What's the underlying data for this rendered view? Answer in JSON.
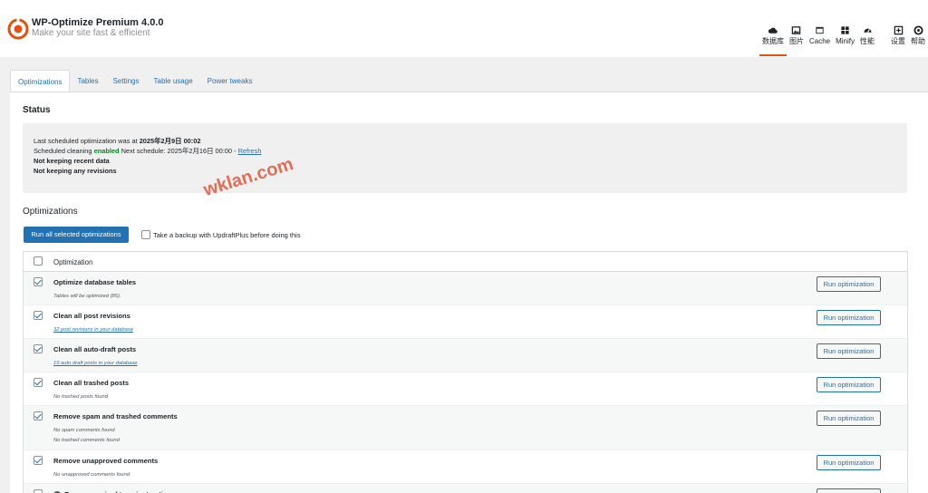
{
  "brand": {
    "title": "WP-Optimize Premium 4.0.0",
    "tagline": "Make your site fast & efficient",
    "accent": "#e5500f"
  },
  "topnav": [
    {
      "label": "数据库",
      "icon": "database-cloud-icon",
      "active": true
    },
    {
      "label": "图片",
      "icon": "image-icon",
      "active": false
    },
    {
      "label": "Cache",
      "icon": "cache-icon",
      "active": false
    },
    {
      "label": "Minify",
      "icon": "minify-grid-icon",
      "active": false
    },
    {
      "label": "性能",
      "icon": "speedometer-icon",
      "active": false
    },
    {
      "label": "设置",
      "icon": "settings-icon",
      "active": false
    },
    {
      "label": "帮助",
      "icon": "help-lifebuoy-icon",
      "active": false
    }
  ],
  "tabs": [
    {
      "label": "Optimizations",
      "active": true
    },
    {
      "label": "Tables",
      "active": false
    },
    {
      "label": "Settings",
      "active": false
    },
    {
      "label": "Table usage",
      "active": false
    },
    {
      "label": "Power tweaks",
      "active": false
    }
  ],
  "status": {
    "heading": "Status",
    "last_prefix": "Last scheduled optimization was at",
    "last_value": "2025年2月9日 00:02",
    "cleaning_prefix": "Scheduled cleaning",
    "cleaning_state": "enabled",
    "next_schedule": "Next schedule: 2025年2月16日 00:00 -",
    "refresh_label": "Refresh",
    "recent_data": "Not keeping recent data",
    "revisions": "Not keeping any revisions"
  },
  "optimizations": {
    "heading": "Optimizations",
    "run_all_label": "Run all selected optimizations",
    "backup_label": "Take a backup with UpdraftPlus before doing this",
    "backup_checked": false,
    "column_header": "Optimization",
    "header_checked": false,
    "run_label": "Run optimization",
    "rows": [
      {
        "title": "Optimize database tables",
        "checked": true,
        "subs": [
          "Tables will be optimized (85)."
        ],
        "sub_is_link": false
      },
      {
        "title": "Clean all post revisions",
        "checked": true,
        "subs": [
          "32 post revisions in your database"
        ],
        "sub_is_link": true
      },
      {
        "title": "Clean all auto-draft posts",
        "checked": true,
        "subs": [
          "19 auto draft posts in your database"
        ],
        "sub_is_link": true
      },
      {
        "title": "Clean all trashed posts",
        "checked": true,
        "subs": [
          "No trashed posts found"
        ],
        "sub_is_link": false
      },
      {
        "title": "Remove spam and trashed comments",
        "checked": true,
        "subs": [
          "No spam comments found",
          "No trashed comments found"
        ],
        "sub_is_link": false
      },
      {
        "title": "Remove unapproved comments",
        "checked": true,
        "subs": [
          "No unapproved comments found"
        ],
        "sub_is_link": false
      },
      {
        "title": "Remove expired transient options",
        "checked": false,
        "subs": [],
        "sub_is_link": false
      }
    ]
  },
  "watermark": "wklan.com"
}
